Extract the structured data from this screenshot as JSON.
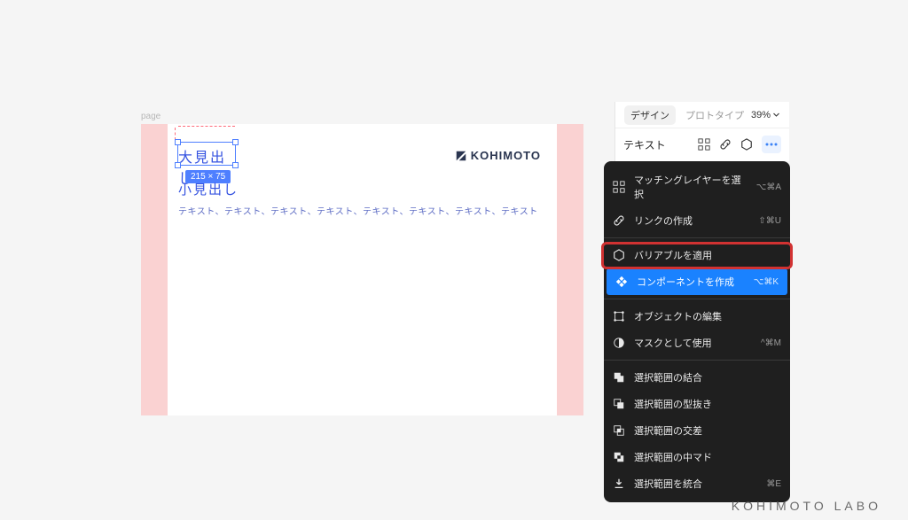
{
  "page_label": "page",
  "canvas": {
    "heading": "大見出し",
    "subheading": "小見出し",
    "body": "テキスト、テキスト、テキスト、テキスト、テキスト、テキスト、テキスト、テキスト",
    "selection_badge": "215 × 75",
    "logo_text": "KOHIMOTO"
  },
  "panel": {
    "tabs": {
      "design": "デザイン",
      "prototype": "プロトタイプ"
    },
    "zoom": "39%",
    "section_label": "テキスト"
  },
  "context_menu": {
    "items": [
      {
        "icon": "grid-icon",
        "label": "マッチングレイヤーを選択",
        "shortcut": "⌥⌘A"
      },
      {
        "icon": "link-icon",
        "label": "リンクの作成",
        "shortcut": "⇧⌘U"
      }
    ],
    "items2": [
      {
        "icon": "variable-icon",
        "label": "バリアブルを適用",
        "shortcut": ""
      }
    ],
    "highlighted": {
      "icon": "component-icon",
      "label": "コンポーネントを作成",
      "shortcut": "⌥⌘K"
    },
    "items3": [
      {
        "icon": "edit-object-icon",
        "label": "オブジェクトの編集",
        "shortcut": ""
      },
      {
        "icon": "mask-icon",
        "label": "マスクとして使用",
        "shortcut": "^⌘M"
      }
    ],
    "items4": [
      {
        "icon": "union-icon",
        "label": "選択範囲の結合",
        "shortcut": ""
      },
      {
        "icon": "subtract-icon",
        "label": "選択範囲の型抜き",
        "shortcut": ""
      },
      {
        "icon": "intersect-icon",
        "label": "選択範囲の交差",
        "shortcut": ""
      },
      {
        "icon": "exclude-icon",
        "label": "選択範囲の中マド",
        "shortcut": ""
      },
      {
        "icon": "flatten-icon",
        "label": "選択範囲を統合",
        "shortcut": "⌘E"
      }
    ]
  },
  "watermark": "KOHIMOTO LABO"
}
